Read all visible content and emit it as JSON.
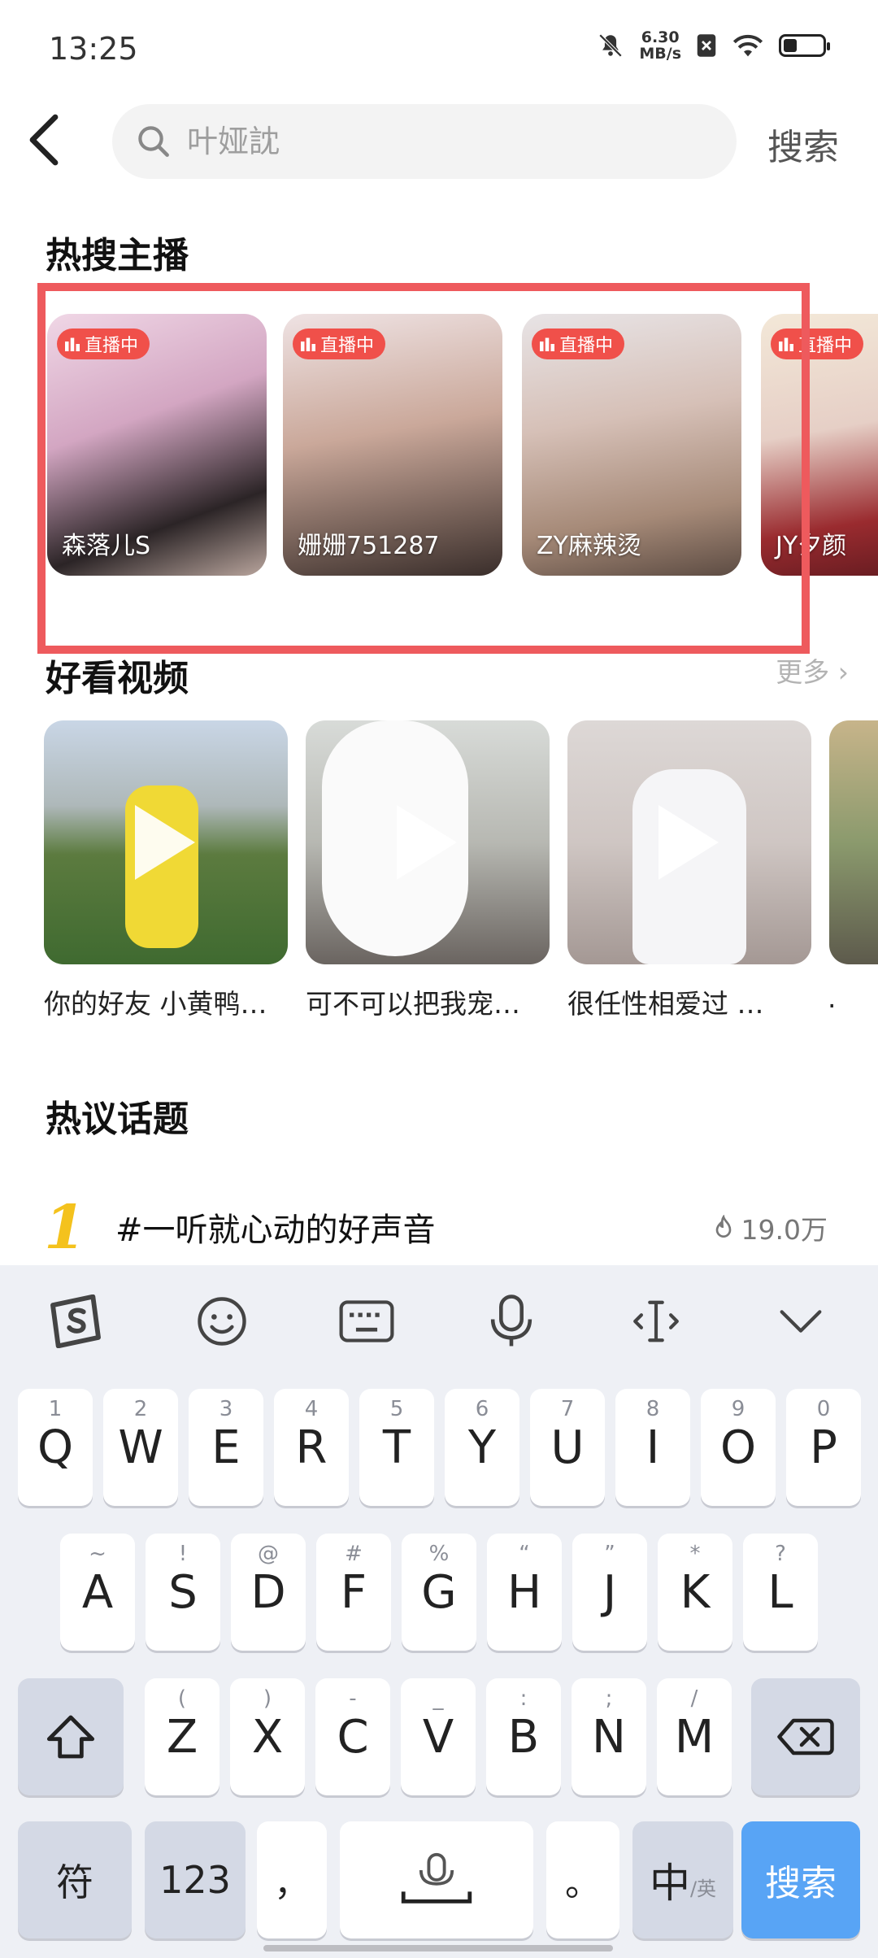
{
  "status": {
    "time": "13:25",
    "net_speed_value": "6.30",
    "net_speed_unit": "MB/s",
    "battery_level": 0.35
  },
  "search": {
    "placeholder": "叶娅訦",
    "button": "搜索"
  },
  "hot_streamers": {
    "title": "热搜主播",
    "live_badge": "直播中",
    "items": [
      {
        "name": "森落儿S"
      },
      {
        "name": "姗姗751287"
      },
      {
        "name": "ZY麻辣烫"
      },
      {
        "name": "JY夕颜"
      }
    ]
  },
  "videos": {
    "title": "好看视频",
    "more": "更多",
    "items": [
      {
        "title": "你的好友 小黄鸭…"
      },
      {
        "title": "可不可以把我宠…"
      },
      {
        "title": "很任性相爱过 …"
      },
      {
        "title": "."
      }
    ]
  },
  "topics": {
    "title": "热议话题",
    "items": [
      {
        "rank": "1",
        "text": "#一听就心动的好声音",
        "heat": "19.0万"
      }
    ]
  },
  "keyboard": {
    "toolbar": [
      "sogou-icon",
      "emoji-icon",
      "keyboard-icon",
      "mic-icon",
      "cursor-icon",
      "collapse-icon"
    ],
    "row1": [
      {
        "k": "Q",
        "s": "1"
      },
      {
        "k": "W",
        "s": "2"
      },
      {
        "k": "E",
        "s": "3"
      },
      {
        "k": "R",
        "s": "4"
      },
      {
        "k": "T",
        "s": "5"
      },
      {
        "k": "Y",
        "s": "6"
      },
      {
        "k": "U",
        "s": "7"
      },
      {
        "k": "I",
        "s": "8"
      },
      {
        "k": "O",
        "s": "9"
      },
      {
        "k": "P",
        "s": "0"
      }
    ],
    "row2": [
      {
        "k": "A",
        "s": "~"
      },
      {
        "k": "S",
        "s": "!"
      },
      {
        "k": "D",
        "s": "@"
      },
      {
        "k": "F",
        "s": "#"
      },
      {
        "k": "G",
        "s": "%"
      },
      {
        "k": "H",
        "s": "“"
      },
      {
        "k": "J",
        "s": "”"
      },
      {
        "k": "K",
        "s": "*"
      },
      {
        "k": "L",
        "s": "?"
      }
    ],
    "row3": [
      {
        "k": "Z",
        "s": "("
      },
      {
        "k": "X",
        "s": ")"
      },
      {
        "k": "C",
        "s": "-"
      },
      {
        "k": "V",
        "s": "_"
      },
      {
        "k": "B",
        "s": ":"
      },
      {
        "k": "N",
        "s": ";"
      },
      {
        "k": "M",
        "s": "/"
      }
    ],
    "symbols": "符",
    "numbers": "123",
    "comma": "，",
    "period": "。",
    "lang_main": "中",
    "lang_alt": "/英",
    "enter": "搜索"
  },
  "colors": {
    "live_badge": "#f0504a",
    "highlight_frame": "#ee5a5d",
    "enter_key": "#58a4f5",
    "rank_gold": "#f4c21d"
  }
}
